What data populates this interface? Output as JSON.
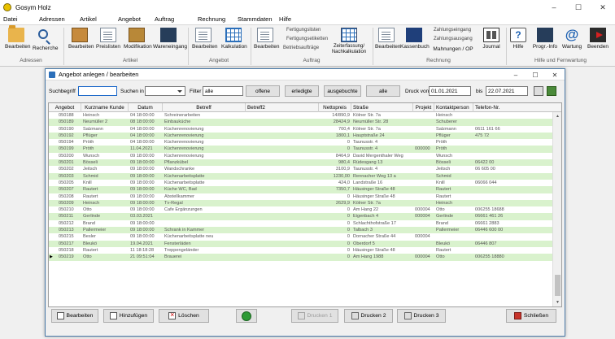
{
  "app": {
    "title": "Gosym Holz",
    "controls": [
      "–",
      "☐",
      "✕"
    ]
  },
  "menu_tabs": [
    "Datei",
    "Adressen",
    "Artikel",
    "Angebot",
    "Auftrag",
    "Rechnung",
    "Stammdaten",
    "Hilfe"
  ],
  "ribbon": {
    "buttons": [
      {
        "label": "Bearbeiten",
        "icon": "folder-icon"
      },
      {
        "label": "Recherche",
        "icon": "magnifier-icon"
      },
      {
        "label": "Bearbeiten",
        "icon": "box-add-icon"
      },
      {
        "label": "Preislisten",
        "icon": "pricelist-icon"
      },
      {
        "label": "Modifikation",
        "icon": "modify-icon"
      },
      {
        "label": "Wareneingang",
        "icon": "goods-in-icon"
      },
      {
        "label": "Bearbeiten",
        "icon": "offer-icon"
      },
      {
        "label": "Kalkulation",
        "icon": "calculator-icon"
      },
      {
        "label": "Bearbeiten",
        "icon": "order-icon"
      },
      {
        "label": "Zeiterfassung/ Nachkalkulation",
        "icon": "clock-icon"
      },
      {
        "label": "Bearbeiten",
        "icon": "invoice-icon"
      },
      {
        "label": "Kassenbuch",
        "icon": "cashbook-icon"
      },
      {
        "label": "Mahnungen / OP",
        "icon": "reminder-icon"
      },
      {
        "label": "Journal",
        "icon": "journal-icon"
      },
      {
        "label": "Hilfe",
        "icon": "help-icon"
      },
      {
        "label": "Progr.-Info",
        "icon": "info-icon"
      },
      {
        "label": "Wartung",
        "icon": "at-icon"
      },
      {
        "label": "Beenden",
        "icon": "exit-icon"
      }
    ],
    "small_items": {
      "auftrag": [
        "Fertigungslisten",
        "Fertigungsetiketten",
        "Betriebsaufträge"
      ],
      "rechnung": [
        "Zahlungseingang",
        "Zahlungsausgang"
      ]
    },
    "groups": [
      "Adressen",
      "Artikel",
      "Angebot",
      "Auftrag",
      "Rechnung",
      "Hilfe und Fernwartung"
    ]
  },
  "child_window": {
    "title": "Angebot anlegen / bearbeiten",
    "controls": [
      "–",
      "☐",
      "✕"
    ],
    "filter": {
      "suchbegriff_label": "Suchbegriff",
      "suchbegriff_value": "",
      "suchen_in_label": "Suchen in",
      "filter_label": "Filter",
      "filter_value": "alle",
      "buttons": [
        "offene",
        "erledigte",
        "ausgebuchte",
        "alle"
      ],
      "druck_von_label": "Druck von",
      "druck_von_value": "01.01.2021",
      "bis_label": "bis",
      "bis_value": "22.07.2021"
    },
    "columns": [
      "Angebot",
      "Kurzname Kunde",
      "Datum",
      "Betreff",
      "Betreff2",
      "Nettopreis",
      "Straße",
      "Projekt",
      "Kontaktperson",
      "Telefon-Nr."
    ],
    "rows": [
      [
        "050188",
        "Heinsch",
        "04 18:00:00",
        "Schreinerarbeiten",
        "",
        "14/890,9",
        "Kölner Str. 7a",
        "",
        "Heinsch",
        ""
      ],
      [
        "050189",
        "Neumüller 2",
        "08 18:00:00",
        "Einbauküche",
        "",
        "28424,9",
        "Neumüller Str. 28",
        "",
        "Schuberer",
        ""
      ],
      [
        "050190",
        "Salzmann",
        "04 18:00:00",
        "Küchenrenovierung",
        "",
        "700,4",
        "Kölner Str. 7a",
        "",
        "Salzmann",
        "0611 161 66"
      ],
      [
        "050192",
        "Pflüger",
        "04 18:00:00",
        "Küchenrenovierung",
        "",
        "1800,1",
        "Hauptstraße 24",
        "",
        "Pflüger",
        "475 72"
      ],
      [
        "050194",
        "Pröth",
        "04 18:00:00",
        "Küchenrenovierung",
        "",
        "0",
        "Taunusstr. 4",
        "",
        "Pröth",
        ""
      ],
      [
        "050199",
        "Pröth",
        "11.04.2021",
        "Küchenrenovierung",
        "",
        "0",
        "Taunusstr. 4",
        "000000",
        "Pröth",
        ""
      ],
      [
        "050200",
        "Wunsch",
        "09 18:00:00",
        "Küchenrenovierung",
        "",
        "8464,9",
        "David Mergenthaler Weg",
        "",
        "Wunsch",
        ""
      ],
      [
        "050201",
        "Bösseli",
        "09 18:00:00",
        "Pflanzkübel",
        "",
        "980,4",
        "Rüdesgang 13",
        "",
        "Bösseli",
        "06422 00"
      ],
      [
        "050202",
        "Jeitsch",
        "09 18:00:00",
        "Wandschranke",
        "",
        "3100,9",
        "Taunusstr. 4",
        "",
        "Jeitsch",
        "06 605 00"
      ],
      [
        "050203",
        "Schmid",
        "09 18:00:00",
        "Küchenarbeitsplatte",
        "",
        "1230,00",
        "Rennacher Weg 13 a",
        "",
        "Schmid",
        ""
      ],
      [
        "050205",
        "Knill",
        "09 18:00:00",
        "Küchenarbeitsplatte",
        "",
        "424,0",
        "Landstraße 16",
        "",
        "Knill",
        "06066 044"
      ],
      [
        "050207",
        "Rautert",
        "09 18:00:00",
        "Küche WC, Bad",
        "",
        "7350,7",
        "Häusinger Straße 48",
        "",
        "Rautert",
        ""
      ],
      [
        "050208",
        "Rautert",
        "09 18:00:00",
        "Abstellkammer",
        "",
        "0",
        "Häusinger Straße 48",
        "",
        "Rautert",
        ""
      ],
      [
        "050209",
        "Heinsch",
        "09 18:00:00",
        "Tv-Regal",
        "",
        "2629,9",
        "Kölner Str. 7a",
        "",
        "Heinsch",
        ""
      ],
      [
        "050210",
        "Otto",
        "09 18:00:00",
        "Cafe Ergänzungen",
        "",
        "0",
        "Am Hang 22",
        "000004",
        "Otto",
        "006255 18688"
      ],
      [
        "050211",
        "Gerlinde",
        "03.03.2021",
        "",
        "",
        "0",
        "Eigenbach 4",
        "000004",
        "Gerlinde",
        "06661 461 26"
      ],
      [
        "050212",
        "Brand",
        "09 18:00:00",
        "",
        "",
        "0",
        "Schlachthofstraße 17",
        "",
        "Brand",
        "06661 2883"
      ],
      [
        "050213",
        "Pallermeier",
        "09 18:00:00",
        "Schrank in Kammer",
        "",
        "0",
        "Talbach 3",
        "",
        "Pallermeier",
        "06446 600 00"
      ],
      [
        "050215",
        "Besler",
        "09 18:00:00",
        "Küchenarbeitsplatte neu",
        "",
        "0",
        "Dornacher Straße 44",
        "000004",
        "",
        ""
      ],
      [
        "050217",
        "Bleukö",
        "19.04.2021",
        "Fensterläden",
        "",
        "0",
        "Oberdorf 5",
        "",
        "Bleukö",
        "06446 807"
      ],
      [
        "050218",
        "Rautert",
        "11 18:18:28",
        "Treppengeländer",
        "",
        "0",
        "Häusinger Straße 48",
        "",
        "Rautert",
        ""
      ],
      [
        "050219",
        "Otto",
        "21 09:51:04",
        "Brauerei",
        "",
        "0",
        "Am Hang 1988",
        "000004",
        "Otto",
        "006255 18880"
      ]
    ],
    "bottom_buttons": {
      "bearbeiten": "Bearbeiten",
      "hinzufuegen": "Hinzufügen",
      "loeschen": "Löschen",
      "drucken1": "Drucken 1",
      "drucken2": "Drucken 2",
      "drucken3": "Drucken 3",
      "schliessen": "Schließen"
    }
  },
  "colors": {
    "row_alt": "#d9f2cd",
    "accent": "#1b68c9"
  }
}
